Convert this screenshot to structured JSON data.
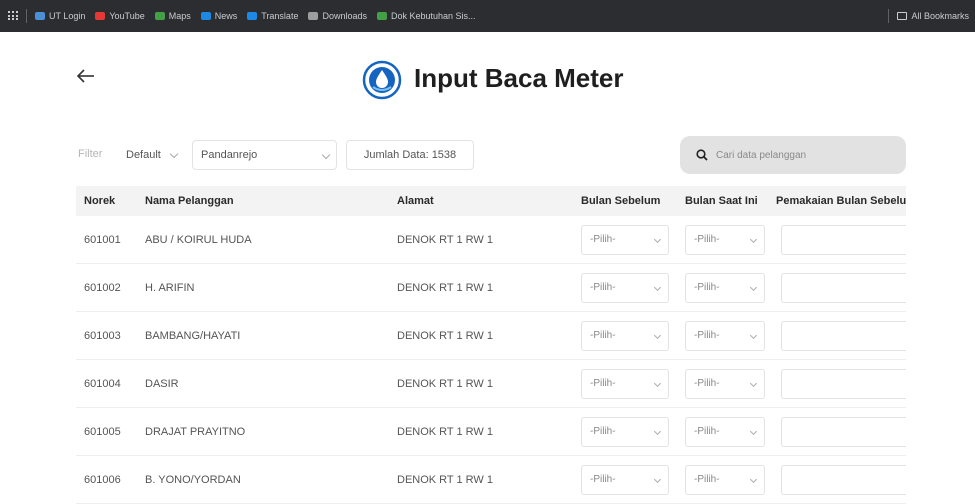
{
  "bookmarks": {
    "items": [
      {
        "label": "UT Login",
        "color": "#4a90d9"
      },
      {
        "label": "YouTube",
        "color": "#e53935"
      },
      {
        "label": "Maps",
        "color": "#43a047"
      },
      {
        "label": "News",
        "color": "#1e88e5"
      },
      {
        "label": "Translate",
        "color": "#1e88e5"
      },
      {
        "label": "Downloads",
        "color": "#9e9e9e"
      },
      {
        "label": "Dok Kebutuhan Sis...",
        "color": "#43a047"
      }
    ],
    "right_label": "All Bookmarks"
  },
  "header": {
    "title": "Input Baca Meter",
    "logo_color": "#1565c0"
  },
  "filter": {
    "label": "Filter",
    "default_select": "Default",
    "area_select": "Pandanrejo",
    "count_text": "Jumlah Data: 1538"
  },
  "search": {
    "placeholder": "Cari data pelanggan"
  },
  "table": {
    "columns": [
      "Norek",
      "Nama Pelanggan",
      "Alamat",
      "Bulan Sebelum",
      "Bulan Saat Ini",
      "Pemakaian Bulan Sebelum"
    ],
    "select_placeholder": "-Pilih-",
    "rows": [
      {
        "norek": "601001",
        "nama": "ABU / KOIRUL HUDA",
        "alamat": "DENOK RT 1 RW 1"
      },
      {
        "norek": "601002",
        "nama": "H. ARIFIN",
        "alamat": "DENOK RT 1 RW 1"
      },
      {
        "norek": "601003",
        "nama": "BAMBANG/HAYATI",
        "alamat": "DENOK RT 1 RW 1"
      },
      {
        "norek": "601004",
        "nama": "DASIR",
        "alamat": "DENOK RT 1 RW 1"
      },
      {
        "norek": "601005",
        "nama": "DRAJAT PRAYITNO",
        "alamat": "DENOK RT 1 RW 1"
      },
      {
        "norek": "601006",
        "nama": "B. YONO/YORDAN",
        "alamat": "DENOK RT 1 RW 1"
      }
    ]
  },
  "colors": {
    "header_bg": "#f3f3f3",
    "search_bg": "#e2e2e2",
    "bookmark_bar_bg": "#2b2d31"
  }
}
